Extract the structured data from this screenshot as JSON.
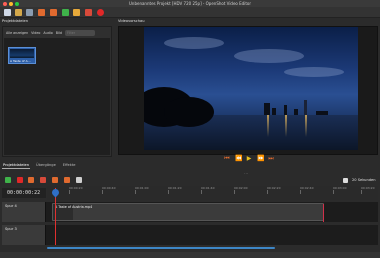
{
  "window": {
    "title": "Unbenanntes Projekt [HDV 720 25p] - OpenShot Video Editor"
  },
  "colors": {
    "accent": "#e06a2f",
    "play": "#e8c01d",
    "selection": "#2d5fa8",
    "playhead": "#e03030"
  },
  "toolbar": {
    "icons": [
      "new-project-icon",
      "open-project-icon",
      "save-project-icon",
      "undo-icon",
      "redo-icon",
      "import-files-icon",
      "profile-icon",
      "export-video-icon",
      "record-icon"
    ]
  },
  "project_files": {
    "title": "Projektdateien",
    "filters": {
      "show_all": "Alle anzeigen",
      "video": "Video",
      "audio": "Audio",
      "image": "Bild"
    },
    "filter_placeholder": "Filter",
    "items": [
      {
        "label": "A Taste of A…"
      }
    ]
  },
  "left_tabs": {
    "project_files": "Projektdateien",
    "transitions": "Übergänge",
    "effects": "Effekte"
  },
  "preview": {
    "title": "Videovorschau"
  },
  "playback": {
    "icons": [
      "jump-start-icon",
      "rewind-icon",
      "play-icon",
      "fast-forward-icon",
      "jump-end-icon"
    ]
  },
  "timeline": {
    "timecode": "00:00:00:22",
    "zoom_label": "20 Sekunden",
    "ruler_ticks": [
      "00:00:20",
      "00:00:40",
      "00:01:00",
      "00:01:20",
      "00:01:40",
      "00:02:00",
      "00:02:20",
      "00:02:40",
      "00:03:00",
      "00:03:20"
    ],
    "tracks": [
      {
        "name": "Spur 4",
        "clip": "A Taste of Austria.mp4"
      },
      {
        "name": "Spur 3"
      }
    ]
  }
}
